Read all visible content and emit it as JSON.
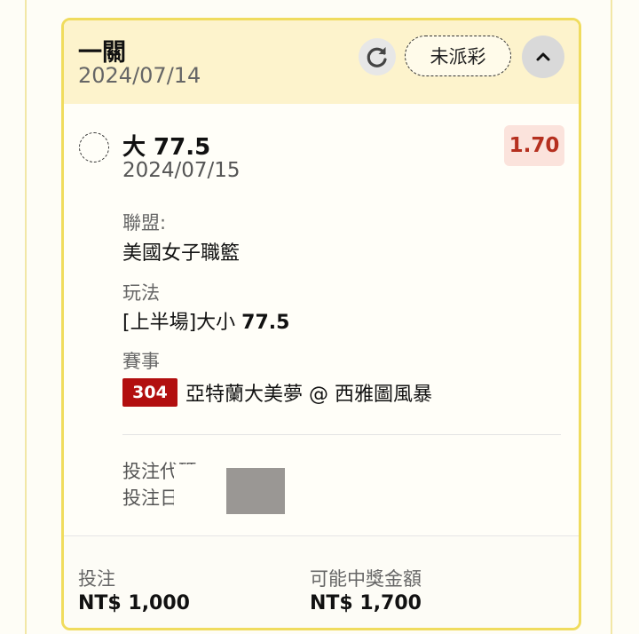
{
  "ticket": {
    "title": "一關",
    "date": "2024/07/14",
    "status_label": "未派彩",
    "icons": {
      "refresh": "refresh-icon",
      "collapse": "chevron-up-icon"
    }
  },
  "selection": {
    "name": "大 77.5",
    "date": "2024/07/15",
    "odds": "1.70",
    "league_label": "聯盟:",
    "league_value": "美國女子職籃",
    "bet_type_label": "玩法",
    "bet_type_prefix": "[上半場]大小 ",
    "bet_type_line": "77.5",
    "event_label": "賽事",
    "event_number": "304",
    "event_name": "亞特蘭大美夢 @ 西雅圖風暴"
  },
  "bet_info": {
    "code_label": "投注代碼",
    "time_label": "投注日"
  },
  "footer": {
    "stake_label": "投注",
    "stake_value": "NT$ 1,000",
    "payout_label": "可能中獎金額",
    "payout_value": "NT$ 1,700"
  },
  "colors": {
    "card_border": "#f0dc5e",
    "header_bg": "#fdf3cc",
    "odds_text": "#b5301f",
    "odds_bg": "#fbe3dc",
    "event_badge": "#b20f0f"
  }
}
